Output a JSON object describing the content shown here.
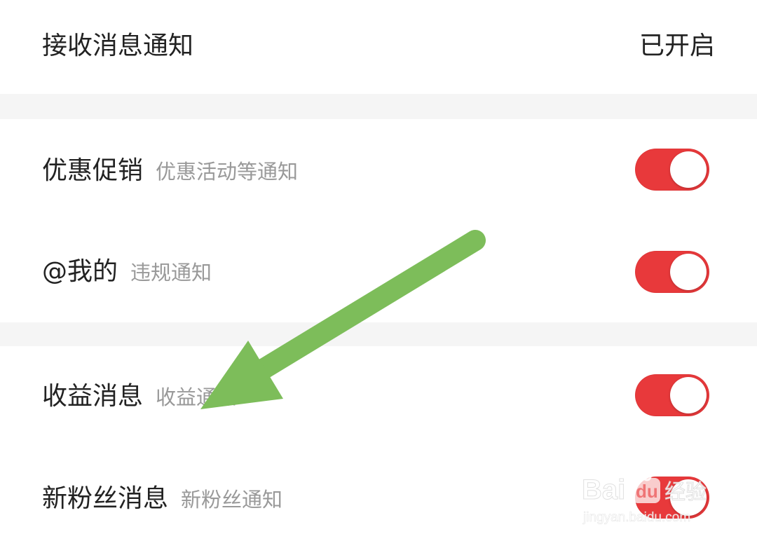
{
  "header_row": {
    "title": "接收消息通知",
    "status": "已开启"
  },
  "settings": [
    {
      "title": "优惠促销",
      "subtitle": "优惠活动等通知",
      "enabled": true
    },
    {
      "title": "@我的",
      "subtitle": "违规通知",
      "enabled": true
    },
    {
      "title": "收益消息",
      "subtitle": "收益通知",
      "enabled": true
    },
    {
      "title": "新粉丝消息",
      "subtitle": "新粉丝通知",
      "enabled": true
    }
  ],
  "colors": {
    "toggle_on": "#e8393b",
    "annotation_arrow": "#7dbd5a",
    "section_gap": "#f5f5f5"
  },
  "watermark": {
    "brand": "Baidu 经验",
    "url": "jingyan.baidu.com"
  }
}
